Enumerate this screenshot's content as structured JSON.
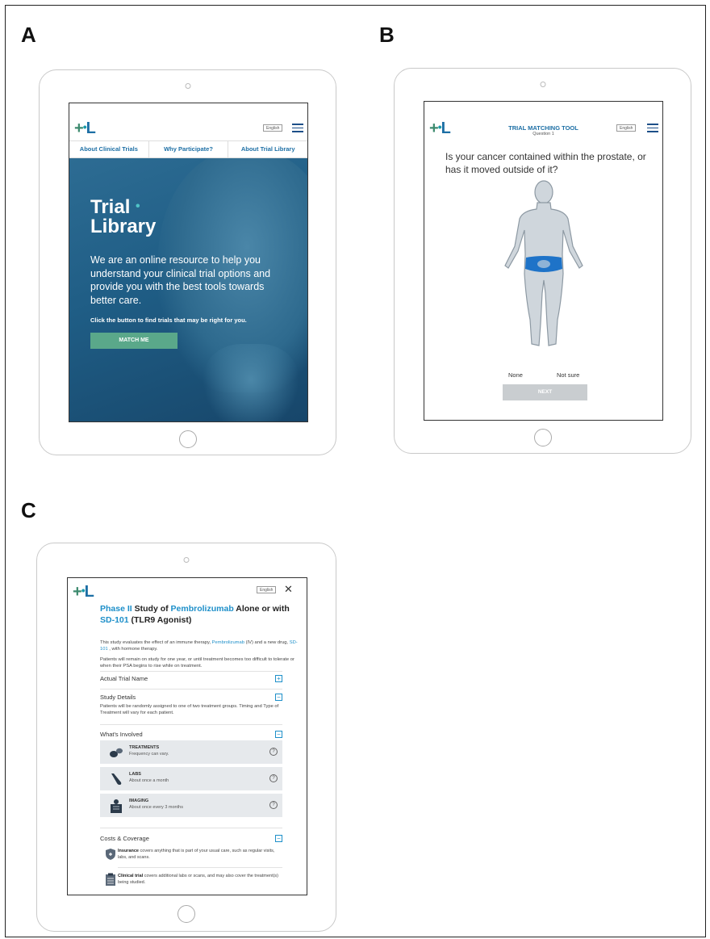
{
  "panels": {
    "a": {
      "letter": "A"
    },
    "b": {
      "letter": "B"
    },
    "c": {
      "letter": "C"
    }
  },
  "brand": {
    "logo": "+•L",
    "primary_color": "#1d6fa5",
    "accent_color": "#3c8a6e"
  },
  "panel_a": {
    "language": "English",
    "nav": [
      "About Clinical Trials",
      "Why Participate?",
      "About Trial Library"
    ],
    "logo_line1": "Trial",
    "logo_line2": "Library",
    "tagline": "We are an online resource to help you understand your clinical trial options and provide you with the best tools towards better care.",
    "cta_text": "Click the button to find trials that may be right for you.",
    "match_button": "MATCH ME",
    "button_color": "#5aa88a",
    "hero_color": "#1f5d85"
  },
  "panel_b": {
    "language": "English",
    "title": "TRIAL MATCHING TOOL",
    "subtitle": "Question 1",
    "question": "Is your cancer contained within the prostate, or has it moved outside of it?",
    "option_none": "None",
    "option_not_sure": "Not sure",
    "next_button": "NEXT",
    "highlight_color": "#1e73c8"
  },
  "panel_c": {
    "language": "English",
    "title_phase": "Phase II",
    "title_study_of": " Study of ",
    "title_drug": "Pembrolizumab",
    "title_alone": " Alone or with ",
    "title_sd": "SD-101",
    "title_rest": " (TLR9 Agonist)",
    "intro_1": "This study evaluates the effect of an immune therapy, ",
    "intro_drug": "Pembrolizumab",
    "intro_2": " (IV) and a new drug, ",
    "intro_sd": "SD-101",
    "intro_3": " , with hormone therapy.",
    "intro_para2": "Patients will remain on study for one year, or until treatment becomes too difficult to tolerate or when their PSA begins to rise while on treatment.",
    "section_actual": "Actual Trial Name",
    "section_details": "Study Details",
    "details_text": "Patients will be randomly assigned to one of two treatment groups. Timing and Type of Treatment will vary for each patient.",
    "section_involved": "What's Involved",
    "cards": [
      {
        "title": "TREATMENTS",
        "sub": "Frequency can vary."
      },
      {
        "title": "LABS",
        "sub": "About once a month"
      },
      {
        "title": "IMAGING",
        "sub": "About once every 3 months"
      }
    ],
    "section_costs": "Costs & Coverage",
    "insurance_bold": "Insurance",
    "insurance_text": " covers anything that is part of your usual care, such as regular visits, labs, and scans.",
    "clinical_bold": "Clinical trial",
    "clinical_text": " covers additional labs or scans, and may also cover the treatment(s) being studied.",
    "toggle_plus": "+",
    "toggle_minus": "−",
    "help_glyph": "?",
    "close_glyph": "✕"
  }
}
